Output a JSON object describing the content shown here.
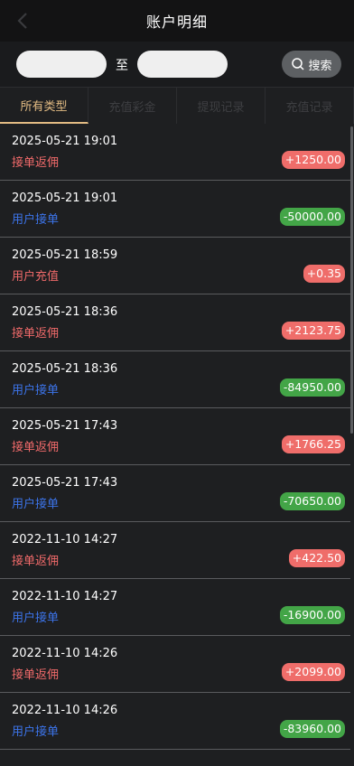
{
  "header": {
    "title": "账户明细"
  },
  "filter": {
    "to_label": "至",
    "search_label": "搜索"
  },
  "tabs": [
    {
      "label": "所有类型",
      "active": true
    },
    {
      "label": "充值彩金",
      "active": false
    },
    {
      "label": "提现记录",
      "active": false
    },
    {
      "label": "充值记录",
      "active": false
    }
  ],
  "records": [
    {
      "time": "2025-05-21 19:01",
      "type": "接单返佣",
      "amount": "+1250.00",
      "kind": "income"
    },
    {
      "time": "2025-05-21 19:01",
      "type": "用户接单",
      "amount": "-50000.00",
      "kind": "expense"
    },
    {
      "time": "2025-05-21 18:59",
      "type": "用户充值",
      "amount": "+0.35",
      "kind": "income"
    },
    {
      "time": "2025-05-21 18:36",
      "type": "接单返佣",
      "amount": "+2123.75",
      "kind": "income"
    },
    {
      "time": "2025-05-21 18:36",
      "type": "用户接单",
      "amount": "-84950.00",
      "kind": "expense"
    },
    {
      "time": "2025-05-21 17:43",
      "type": "接单返佣",
      "amount": "+1766.25",
      "kind": "income"
    },
    {
      "time": "2025-05-21 17:43",
      "type": "用户接单",
      "amount": "-70650.00",
      "kind": "expense"
    },
    {
      "time": "2022-11-10 14:27",
      "type": "接单返佣",
      "amount": "+422.50",
      "kind": "income"
    },
    {
      "time": "2022-11-10 14:27",
      "type": "用户接单",
      "amount": "-16900.00",
      "kind": "expense"
    },
    {
      "time": "2022-11-10 14:26",
      "type": "接单返佣",
      "amount": "+2099.00",
      "kind": "income"
    },
    {
      "time": "2022-11-10 14:26",
      "type": "用户接单",
      "amount": "-83960.00",
      "kind": "expense"
    }
  ],
  "colors": {
    "income": "#ef6d6a",
    "expense": "#43a547",
    "type_red": "#f06a6a",
    "type_blue": "#3c74ea",
    "active_tab": "#e2bb83"
  }
}
